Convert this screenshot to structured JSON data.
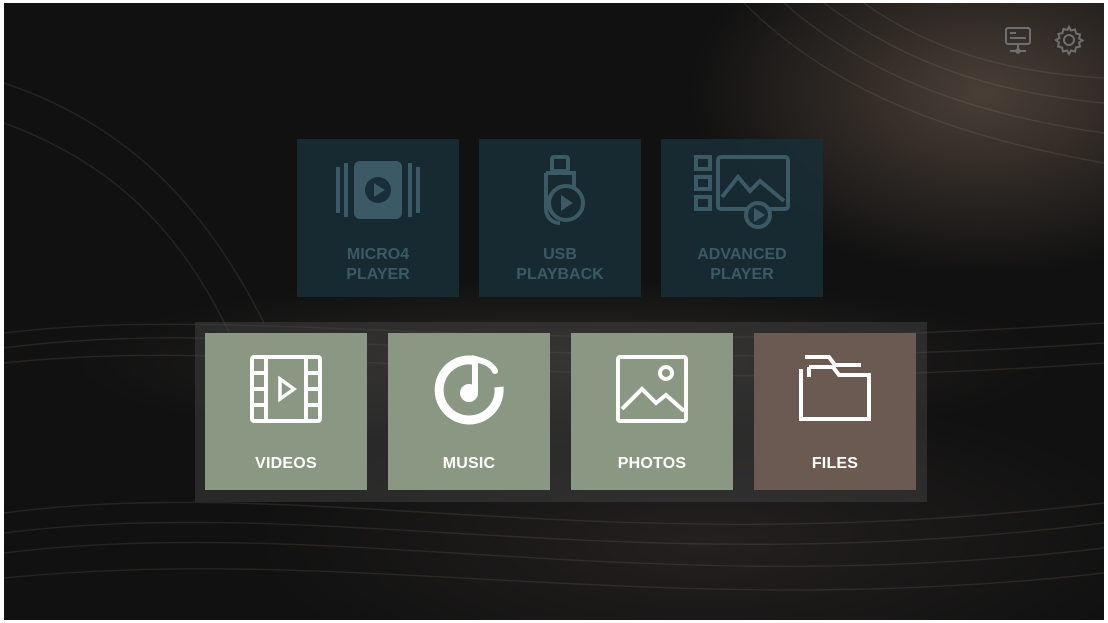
{
  "top_bar": {
    "icons": [
      "network-media-icon",
      "gear-icon"
    ]
  },
  "top_tiles": [
    {
      "label": "MICRO4\nPLAYER",
      "icon": "video-player-icon"
    },
    {
      "label": "USB\nPLAYBACK",
      "icon": "usb-play-icon"
    },
    {
      "label": "ADVANCED\nPLAYER",
      "icon": "advanced-player-icon"
    }
  ],
  "bottom_tiles": [
    {
      "label": "VIDEOS",
      "icon": "film-icon"
    },
    {
      "label": "MUSIC",
      "icon": "music-note-icon"
    },
    {
      "label": "PHOTOS",
      "icon": "image-icon"
    },
    {
      "label": "FILES",
      "icon": "folder-icon"
    }
  ],
  "colors": {
    "top_tile_bg": "#182e38",
    "top_tile_fg": "#3c5a66",
    "media_tile_bg": "#8a9782",
    "files_tile_bg": "#6b5a51",
    "tile_text": "#ffffff"
  }
}
